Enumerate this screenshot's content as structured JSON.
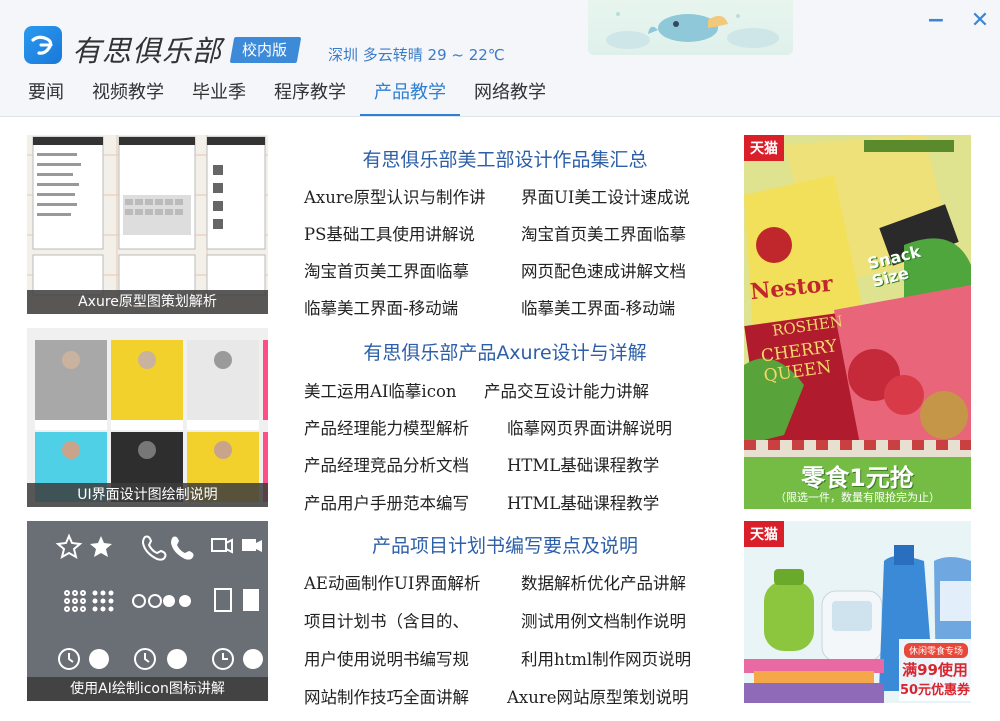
{
  "header": {
    "app_title": "有思俱乐部",
    "badge": "校内版",
    "weather": "深圳 多云转晴 29 ~ 22℃",
    "minimize_label": "−",
    "close_label": "✕"
  },
  "tabs": [
    "要闻",
    "视频教学",
    "毕业季",
    "程序教学",
    "产品教学",
    "网络教学"
  ],
  "active_tab": 4,
  "thumbnails": [
    {
      "caption": "Axure原型图策划解析"
    },
    {
      "caption": "UI界面设计图绘制说明"
    },
    {
      "caption": "使用AI绘制icon图标讲解"
    }
  ],
  "sections": [
    {
      "title": "有思俱乐部美工部设计作品集汇总",
      "links": [
        "Axure原型认识与制作讲",
        "界面UI美工设计速成说",
        "PS基础工具使用讲解说",
        "淘宝首页美工界面临摹",
        "淘宝首页美工界面临摹",
        "网页配色速成讲解文档",
        "临摹美工界面-移动端",
        "临摹美工界面-移动端"
      ]
    },
    {
      "title": "有思俱乐部产品Axure设计与详解",
      "links": [
        "美工运用AI临摹icon",
        "产品交互设计能力讲解",
        "产品经理能力模型解析",
        "临摹网页界面讲解说明",
        "产品经理竞品分析文档",
        "HTML基础课程教学",
        "产品用户手册范本编写",
        "HTML基础课程教学"
      ]
    },
    {
      "title": "产品项目计划书编写要点及说明",
      "links": [
        "AE动画制作UI界面解析",
        "数据解析优化产品讲解",
        "项目计划书（含目的、",
        "测试用例文档制作说明",
        "用户使用说明书编写规",
        "利用html制作网页说明",
        "网站制作技巧全面讲解",
        "Axure网站原型策划说明"
      ]
    }
  ],
  "ads": {
    "ad1": {
      "tag": "天猫",
      "brand1": "Nestor",
      "brand2": "ROSHEN",
      "product": "CHERRY QUEEN",
      "snack": "Snack Size",
      "headline": "零食1元抢",
      "subline": "（限选一件，数量有限抢完为止）"
    },
    "ad2": {
      "tag": "天猫",
      "promo1": "休闲零食专场",
      "promo2": "满99使用",
      "promo3": "50元优惠券"
    }
  },
  "colors": {
    "accent": "#2f7fd3",
    "header_bg": "#f4f6fa",
    "section_title": "#2c5fa8",
    "tmall_red": "#d91f2a"
  }
}
